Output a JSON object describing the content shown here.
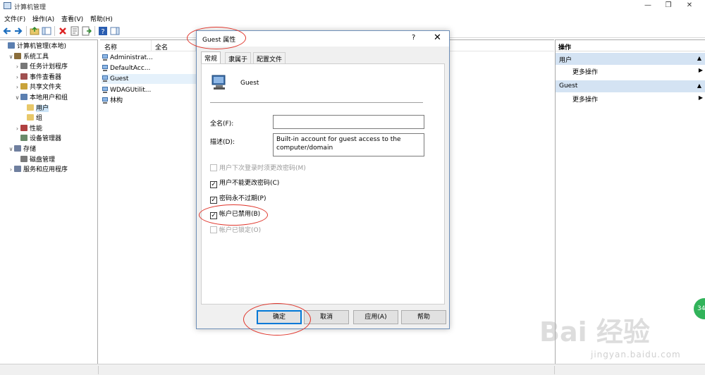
{
  "window": {
    "title": "计算机管理",
    "minimize": "—",
    "restore": "❐",
    "close": "✕"
  },
  "menu": [
    "文件(F)",
    "操作(A)",
    "查看(V)",
    "帮助(H)"
  ],
  "tree": [
    {
      "label": "计算机管理(本地)",
      "exp": "",
      "indent": 0,
      "icon_color": "#5b7fb0"
    },
    {
      "label": "系统工具",
      "exp": "∨",
      "indent": 1,
      "icon_color": "#8a6d3b"
    },
    {
      "label": "任务计划程序",
      "exp": "›",
      "indent": 2,
      "icon_color": "#777777"
    },
    {
      "label": "事件查看器",
      "exp": "›",
      "indent": 2,
      "icon_color": "#a05050"
    },
    {
      "label": "共享文件夹",
      "exp": "›",
      "indent": 2,
      "icon_color": "#c9a33a"
    },
    {
      "label": "本地用户和组",
      "exp": "∨",
      "indent": 2,
      "icon_color": "#5b7fb0"
    },
    {
      "label": "用户",
      "exp": "",
      "indent": 3,
      "icon_color": "#e8c86a"
    },
    {
      "label": "组",
      "exp": "",
      "indent": 3,
      "icon_color": "#e8c86a"
    },
    {
      "label": "性能",
      "exp": "›",
      "indent": 2,
      "icon_color": "#b04040"
    },
    {
      "label": "设备管理器",
      "exp": "",
      "indent": 2,
      "icon_color": "#6a8a6a"
    },
    {
      "label": "存储",
      "exp": "∨",
      "indent": 1,
      "icon_color": "#6f7f9f"
    },
    {
      "label": "磁盘管理",
      "exp": "",
      "indent": 2,
      "icon_color": "#7a7a7a"
    },
    {
      "label": "服务和应用程序",
      "exp": "›",
      "indent": 1,
      "icon_color": "#6f7f9f"
    }
  ],
  "list": {
    "columns": [
      "名称",
      "全名"
    ],
    "rows": [
      "Administrat...",
      "DefaultAcc...",
      "Guest",
      "WDAGUtilit...",
      "林构"
    ]
  },
  "actions": {
    "title": "操作",
    "groups": [
      {
        "name": "用户",
        "item": "更多操作"
      },
      {
        "name": "Guest",
        "item": "更多操作"
      }
    ]
  },
  "dialog": {
    "title": "Guest 属性",
    "help": "?",
    "close": "✕",
    "tabs": [
      "常规",
      "隶属于",
      "配置文件"
    ],
    "username": "Guest",
    "fullname_label": "全名(F):",
    "fullname_value": "",
    "desc_label": "描述(D):",
    "desc_value": "Built-in account for guest access to the computer/domain",
    "checkboxes": [
      {
        "label": "用户下次登录时须更改密码(M)",
        "checked": false,
        "disabled": true
      },
      {
        "label": "用户不能更改密码(C)",
        "checked": true,
        "disabled": false
      },
      {
        "label": "密码永不过期(P)",
        "checked": true,
        "disabled": false
      },
      {
        "label": "帐户已禁用(B)",
        "checked": true,
        "disabled": false
      },
      {
        "label": "帐户已锁定(O)",
        "checked": false,
        "disabled": true
      }
    ],
    "buttons": {
      "ok": "确定",
      "cancel": "取消",
      "apply": "应用(A)",
      "help": "帮助"
    }
  },
  "watermark": {
    "logo": "Bai 经验",
    "url": "jingyan.baidu.com"
  },
  "badge": "34"
}
